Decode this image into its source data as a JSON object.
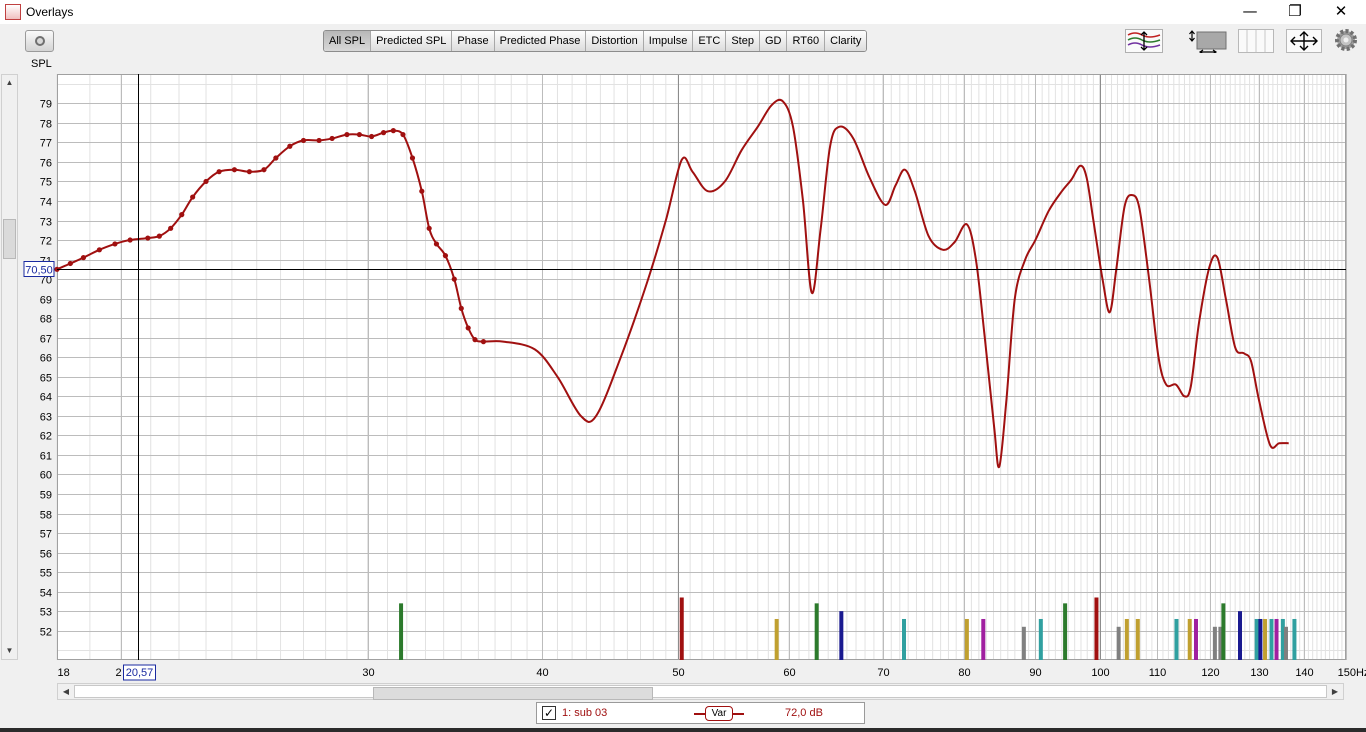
{
  "window": {
    "title": "Overlays",
    "minimize": "—",
    "restore": "❐",
    "close": "✕"
  },
  "toolbar": {
    "tabs": [
      "All SPL",
      "Predicted SPL",
      "Phase",
      "Predicted Phase",
      "Distortion",
      "Impulse",
      "ETC",
      "Step",
      "GD",
      "RT60",
      "Clarity"
    ],
    "active_tab": "All SPL",
    "icons": [
      "camera-icon",
      "trace-arrange-icon",
      "vertical-resize-icon",
      "column-layout-icon",
      "pan-arrows-icon",
      "settings-gear-icon"
    ]
  },
  "colors": {
    "trace": "#a01010",
    "grid_major": "#bcbcbc",
    "grid_minor": "#e2e2e2",
    "plot_bg": "#ffffff",
    "cursor": "#000000",
    "label_box": "#1a2aa0"
  },
  "legend": {
    "checked": true,
    "check_mark": "✓",
    "name": "1: sub 03",
    "badge": "Var",
    "value": "72,0 dB"
  },
  "chart_data": {
    "type": "line",
    "x_scale": "log",
    "xlim": [
      18,
      150
    ],
    "ylim": [
      50.5,
      80.5
    ],
    "ylabel": "SPL",
    "x_unit": "Hz",
    "x_ticks": [
      {
        "v": 18,
        "label": "18"
      },
      {
        "v": 20,
        "label": "2"
      },
      {
        "v": 30,
        "label": "30"
      },
      {
        "v": 40,
        "label": "40"
      },
      {
        "v": 50,
        "label": "50"
      },
      {
        "v": 60,
        "label": "60"
      },
      {
        "v": 70,
        "label": "70"
      },
      {
        "v": 80,
        "label": "80"
      },
      {
        "v": 90,
        "label": "90"
      },
      {
        "v": 100,
        "label": "100"
      },
      {
        "v": 110,
        "label": "110"
      },
      {
        "v": 120,
        "label": "120"
      },
      {
        "v": 130,
        "label": "130"
      },
      {
        "v": 140,
        "label": "140"
      },
      {
        "v": 150,
        "label": "150Hz"
      }
    ],
    "y_ticks": [
      52,
      53,
      54,
      55,
      56,
      57,
      58,
      59,
      60,
      61,
      62,
      63,
      64,
      65,
      66,
      67,
      68,
      69,
      70,
      71,
      72,
      73,
      74,
      75,
      76,
      77,
      78,
      79
    ],
    "cursor": {
      "x": 20.57,
      "y": 70.5,
      "x_label": "20,57",
      "y_label": "70,50"
    },
    "marker_x_max": 37,
    "series": [
      {
        "name": "1: sub 03",
        "points": [
          [
            18.0,
            70.5
          ],
          [
            18.4,
            70.8
          ],
          [
            18.8,
            71.1
          ],
          [
            19.3,
            71.5
          ],
          [
            19.8,
            71.8
          ],
          [
            20.3,
            72.0
          ],
          [
            20.9,
            72.1
          ],
          [
            21.3,
            72.2
          ],
          [
            21.7,
            72.6
          ],
          [
            22.1,
            73.3
          ],
          [
            22.5,
            74.2
          ],
          [
            23.0,
            75.0
          ],
          [
            23.5,
            75.5
          ],
          [
            24.1,
            75.6
          ],
          [
            24.7,
            75.5
          ],
          [
            25.3,
            75.6
          ],
          [
            25.8,
            76.2
          ],
          [
            26.4,
            76.8
          ],
          [
            27.0,
            77.1
          ],
          [
            27.7,
            77.1
          ],
          [
            28.3,
            77.2
          ],
          [
            29.0,
            77.4
          ],
          [
            29.6,
            77.4
          ],
          [
            30.2,
            77.3
          ],
          [
            30.8,
            77.5
          ],
          [
            31.3,
            77.6
          ],
          [
            31.8,
            77.4
          ],
          [
            32.3,
            76.2
          ],
          [
            32.8,
            74.5
          ],
          [
            33.2,
            72.6
          ],
          [
            33.6,
            71.8
          ],
          [
            34.1,
            71.2
          ],
          [
            34.6,
            70.0
          ],
          [
            35.0,
            68.5
          ],
          [
            35.4,
            67.5
          ],
          [
            35.8,
            66.9
          ],
          [
            36.3,
            66.8
          ],
          [
            37.5,
            66.8
          ],
          [
            39.5,
            66.4
          ],
          [
            41.0,
            65.0
          ],
          [
            42.6,
            63.0
          ],
          [
            43.7,
            63.0
          ],
          [
            45.5,
            66.0
          ],
          [
            47.5,
            69.8
          ],
          [
            49.0,
            73.0
          ],
          [
            50.3,
            76.1
          ],
          [
            51.2,
            75.5
          ],
          [
            52.5,
            74.5
          ],
          [
            54.0,
            75.0
          ],
          [
            55.5,
            76.6
          ],
          [
            57.0,
            77.8
          ],
          [
            58.3,
            78.9
          ],
          [
            59.4,
            79.1
          ],
          [
            60.4,
            77.8
          ],
          [
            61.4,
            74.0
          ],
          [
            62.3,
            69.3
          ],
          [
            63.2,
            72.5
          ],
          [
            64.2,
            76.8
          ],
          [
            65.2,
            77.8
          ],
          [
            66.7,
            77.2
          ],
          [
            68.5,
            75.2
          ],
          [
            70.3,
            73.8
          ],
          [
            71.5,
            74.8
          ],
          [
            72.6,
            75.6
          ],
          [
            73.8,
            74.5
          ],
          [
            75.5,
            72.2
          ],
          [
            77.3,
            71.5
          ],
          [
            78.8,
            71.9
          ],
          [
            80.4,
            72.8
          ],
          [
            81.6,
            71.0
          ],
          [
            82.8,
            67.0
          ],
          [
            84.1,
            62.4
          ],
          [
            84.8,
            60.4
          ],
          [
            85.8,
            63.8
          ],
          [
            87.0,
            69.0
          ],
          [
            88.5,
            71.0
          ],
          [
            90.0,
            72.0
          ],
          [
            92.0,
            73.5
          ],
          [
            94.0,
            74.5
          ],
          [
            95.5,
            75.1
          ],
          [
            96.9,
            75.8
          ],
          [
            97.9,
            75.2
          ],
          [
            99.0,
            73.0
          ],
          [
            100.5,
            70.0
          ],
          [
            101.7,
            68.3
          ],
          [
            102.8,
            70.5
          ],
          [
            104.2,
            73.7
          ],
          [
            105.5,
            74.3
          ],
          [
            106.8,
            73.6
          ],
          [
            108.5,
            70.0
          ],
          [
            110.2,
            66.0
          ],
          [
            111.6,
            64.6
          ],
          [
            113.4,
            64.6
          ],
          [
            115.0,
            64.0
          ],
          [
            116.2,
            64.5
          ],
          [
            117.8,
            67.8
          ],
          [
            119.8,
            70.6
          ],
          [
            121.4,
            71.1
          ],
          [
            123.1,
            69.0
          ],
          [
            125.0,
            66.5
          ],
          [
            126.8,
            66.2
          ],
          [
            128.3,
            65.8
          ],
          [
            130.0,
            63.8
          ],
          [
            132.4,
            61.5
          ],
          [
            134.4,
            61.6
          ],
          [
            136.5,
            61.6
          ]
        ]
      }
    ],
    "bars": [
      {
        "x": 31.7,
        "h": 53.4,
        "color": "#2c7a2c"
      },
      {
        "x": 50.3,
        "h": 53.7,
        "color": "#a01010"
      },
      {
        "x": 58.8,
        "h": 52.6,
        "color": "#c0a030"
      },
      {
        "x": 62.8,
        "h": 53.4,
        "color": "#2c7a2c"
      },
      {
        "x": 65.4,
        "h": 53.0,
        "color": "#1a1a90"
      },
      {
        "x": 72.5,
        "h": 52.6,
        "color": "#30a0a0"
      },
      {
        "x": 80.4,
        "h": 52.6,
        "color": "#c0a030"
      },
      {
        "x": 82.6,
        "h": 52.6,
        "color": "#a020a0"
      },
      {
        "x": 88.3,
        "h": 52.2,
        "color": "#808080"
      },
      {
        "x": 90.8,
        "h": 52.6,
        "color": "#30a0a0"
      },
      {
        "x": 94.5,
        "h": 53.4,
        "color": "#2c7a2c"
      },
      {
        "x": 99.5,
        "h": 53.7,
        "color": "#a01010"
      },
      {
        "x": 103.2,
        "h": 52.2,
        "color": "#808080"
      },
      {
        "x": 104.6,
        "h": 52.6,
        "color": "#c0a030"
      },
      {
        "x": 106.5,
        "h": 52.6,
        "color": "#c0a030"
      },
      {
        "x": 113.5,
        "h": 52.6,
        "color": "#30a0a0"
      },
      {
        "x": 116.0,
        "h": 52.6,
        "color": "#c0a030"
      },
      {
        "x": 117.2,
        "h": 52.6,
        "color": "#a020a0"
      },
      {
        "x": 120.9,
        "h": 52.2,
        "color": "#808080"
      },
      {
        "x": 122.0,
        "h": 52.2,
        "color": "#808080"
      },
      {
        "x": 122.6,
        "h": 53.4,
        "color": "#2c7a2c"
      },
      {
        "x": 126.0,
        "h": 53.0,
        "color": "#1a1a90"
      },
      {
        "x": 129.5,
        "h": 52.6,
        "color": "#30a0a0"
      },
      {
        "x": 130.3,
        "h": 52.6,
        "color": "#1a1a90"
      },
      {
        "x": 131.3,
        "h": 52.6,
        "color": "#c0a030"
      },
      {
        "x": 132.7,
        "h": 52.6,
        "color": "#30a0a0"
      },
      {
        "x": 133.8,
        "h": 52.6,
        "color": "#a020a0"
      },
      {
        "x": 135.2,
        "h": 52.6,
        "color": "#30a0a0"
      },
      {
        "x": 135.9,
        "h": 52.2,
        "color": "#808080"
      },
      {
        "x": 137.8,
        "h": 52.6,
        "color": "#30a0a0"
      }
    ]
  }
}
